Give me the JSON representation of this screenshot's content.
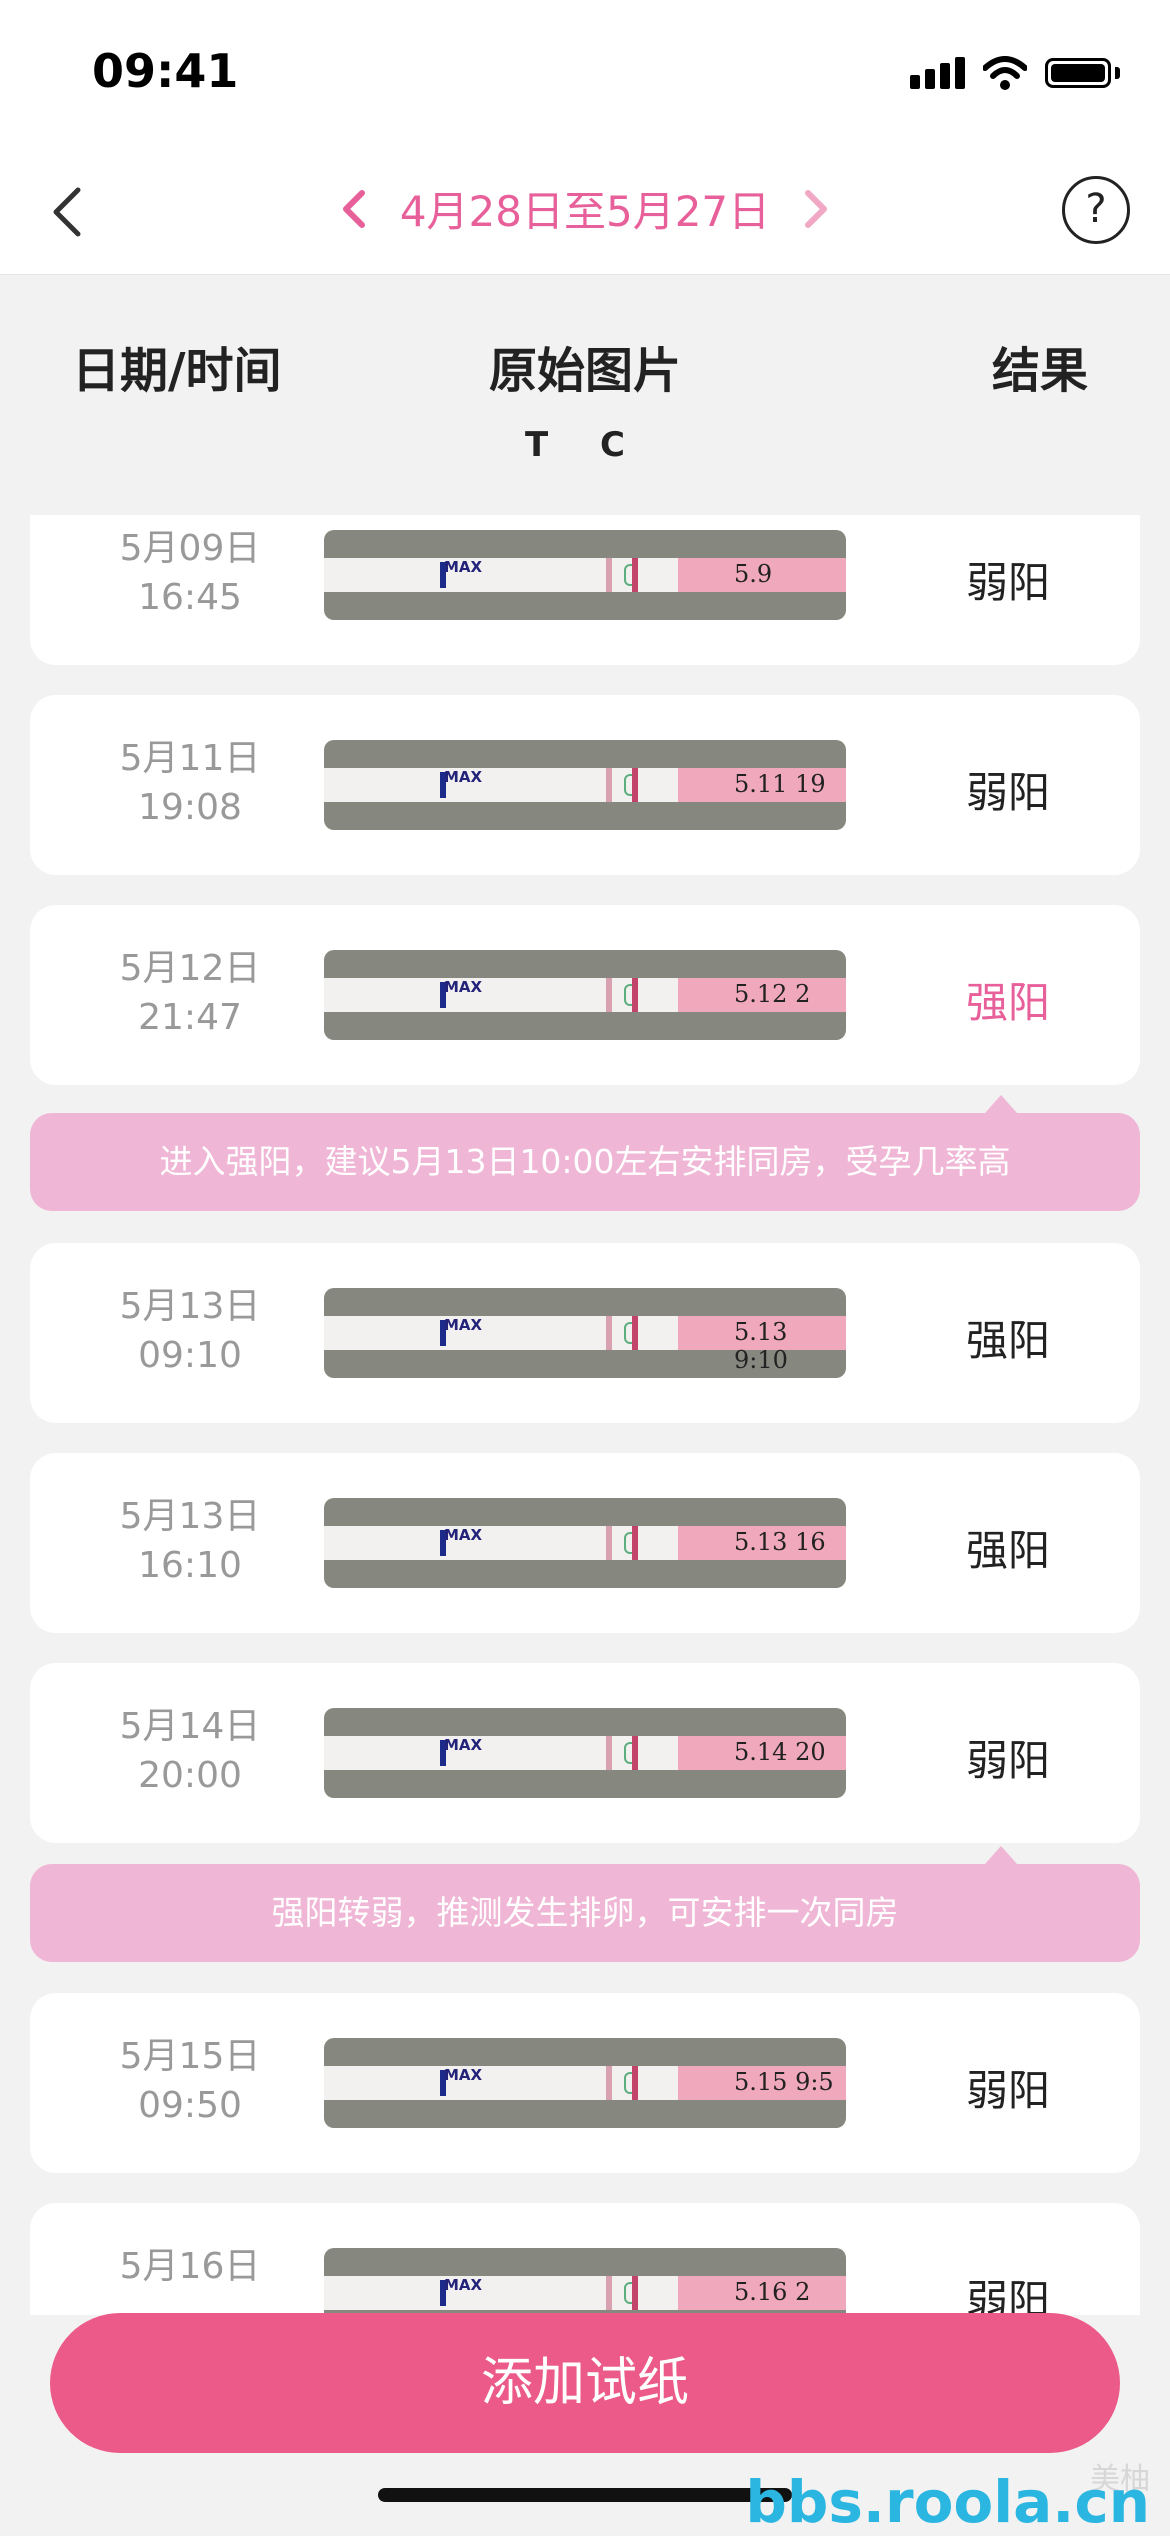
{
  "status_bar": {
    "time": "09:41"
  },
  "nav": {
    "range_label": "4月28日至5月27日",
    "help_label": "?"
  },
  "columns": {
    "date_time": "日期/时间",
    "photo": "原始图片",
    "result": "结果",
    "tc_label": "T C"
  },
  "records": [
    {
      "date": "5月09日",
      "time": "16:45",
      "result": "弱阳",
      "strong": false,
      "strip_note": "5.9"
    },
    {
      "date": "5月11日",
      "time": "19:08",
      "result": "弱阳",
      "strong": false,
      "strip_note": "5.11 19"
    },
    {
      "date": "5月12日",
      "time": "21:47",
      "result": "强阳",
      "strong": true,
      "strip_note": "5.12 2"
    },
    {
      "date": "5月13日",
      "time": "09:10",
      "result": "强阳",
      "strong": false,
      "strip_note": "5.13 9:10"
    },
    {
      "date": "5月13日",
      "time": "16:10",
      "result": "强阳",
      "strong": false,
      "strip_note": "5.13 16"
    },
    {
      "date": "5月14日",
      "time": "20:00",
      "result": "弱阳",
      "strong": false,
      "strip_note": "5.14 20"
    },
    {
      "date": "5月15日",
      "time": "09:50",
      "result": "弱阳",
      "strong": false,
      "strip_note": "5.15 9:5"
    },
    {
      "date": "5月16日",
      "time": "",
      "result": "弱阳",
      "strong": false,
      "strip_note": "5.16 2"
    }
  ],
  "strip_label": "MAX",
  "advice": [
    {
      "text": "进入强阳，建议5月13日10:00左右安排同房，受孕几率高"
    },
    {
      "text": "强阳转弱，推测发生排卵，可安排一次同房"
    }
  ],
  "add_button": {
    "label": "添加试纸"
  },
  "watermark": {
    "site": "bbs.roola.cn",
    "logo_text": "美柚"
  },
  "colors": {
    "accent": "#e8609a",
    "button": "#eb5a88",
    "advice_bg": "#efb6d5",
    "page_bg": "#f2f2f2"
  },
  "icons": [
    "back-arrow-icon",
    "chevron-left-icon",
    "chevron-right-icon",
    "help-icon",
    "signal-icon",
    "wifi-icon",
    "battery-icon"
  ]
}
